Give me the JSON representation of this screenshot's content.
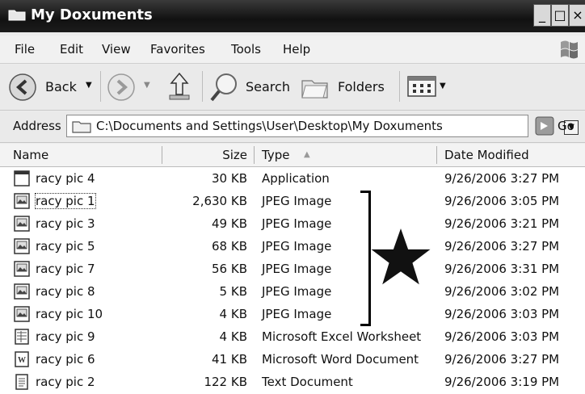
{
  "window": {
    "title": "My Doxuments",
    "controls": [
      "_",
      "□",
      "×"
    ]
  },
  "menu": [
    "File",
    "Edit",
    "View",
    "Favorites",
    "Tools",
    "Help"
  ],
  "toolbar": {
    "back": "Back",
    "search": "Search",
    "folders": "Folders"
  },
  "address": {
    "label": "Address",
    "path": "C:\\Documents and Settings\\User\\Desktop\\My Doxuments",
    "go": "Go"
  },
  "columns": {
    "name": "Name",
    "size": "Size",
    "type": "Type",
    "date": "Date Modified"
  },
  "files": [
    {
      "name": "racy pic 4",
      "size": "30 KB",
      "type": "Application",
      "date": "9/26/2006 3:27 PM",
      "icon": "application-icon"
    },
    {
      "name": "racy pic 1",
      "size": "2,630 KB",
      "type": "JPEG Image",
      "date": "9/26/2006 3:05 PM",
      "icon": "image-icon"
    },
    {
      "name": "racy pic 3",
      "size": "49 KB",
      "type": "JPEG Image",
      "date": "9/26/2006 3:21 PM",
      "icon": "image-icon"
    },
    {
      "name": "racy pic 5",
      "size": "68 KB",
      "type": "JPEG Image",
      "date": "9/26/2006 3:27 PM",
      "icon": "image-icon"
    },
    {
      "name": "racy pic 7",
      "size": "56 KB",
      "type": "JPEG Image",
      "date": "9/26/2006 3:31 PM",
      "icon": "image-icon"
    },
    {
      "name": "racy pic 8",
      "size": "5 KB",
      "type": "JPEG Image",
      "date": "9/26/2006 3:02 PM",
      "icon": "image-icon"
    },
    {
      "name": "racy pic 10",
      "size": "4 KB",
      "type": "JPEG Image",
      "date": "9/26/2006 3:03 PM",
      "icon": "image-icon"
    },
    {
      "name": "racy pic 9",
      "size": "4 KB",
      "type": "Microsoft Excel Worksheet",
      "date": "9/26/2006 3:03 PM",
      "icon": "excel-icon"
    },
    {
      "name": "racy pic 6",
      "size": "41 KB",
      "type": "Microsoft Word Document",
      "date": "9/26/2006 3:27 PM",
      "icon": "word-icon"
    },
    {
      "name": "racy pic 2",
      "size": "122 KB",
      "type": "Text Document",
      "date": "9/26/2006 3:19 PM",
      "icon": "text-document-icon"
    }
  ],
  "annotation": {
    "marker": "star-icon",
    "color": "#111111"
  }
}
